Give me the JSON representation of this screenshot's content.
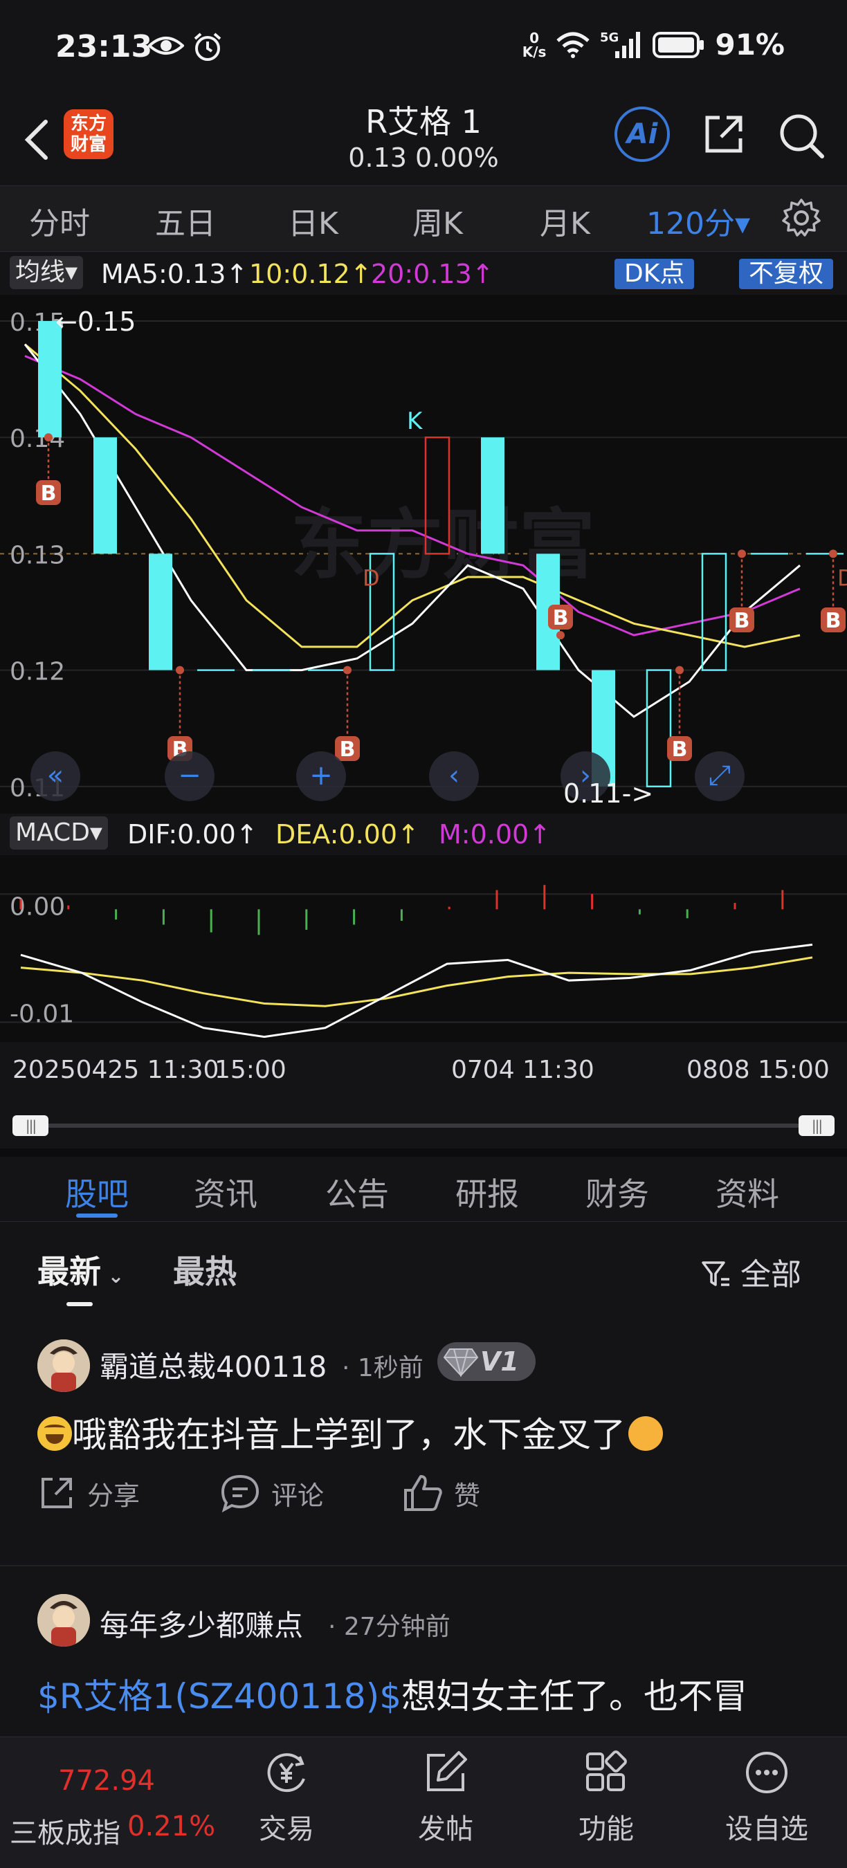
{
  "status_bar": {
    "time": "23:13",
    "net_speed_value": "0",
    "net_speed_unit": "K/s",
    "battery": "91%"
  },
  "header": {
    "logo_text": "东方财富",
    "title": "R艾格 1",
    "subtitle": "0.13   0.00%",
    "ai_label": "Ai"
  },
  "period_tabs": {
    "tabs": [
      "分时",
      "五日",
      "日K",
      "周K",
      "月K",
      "120分▾"
    ],
    "active": "120分▾"
  },
  "ma_legend": {
    "selector": "均线▾",
    "ma5": "MA5:0.13↑",
    "ma10": "10:0.12↑",
    "ma20": "20:0.13↑",
    "dk_button": "DK点",
    "adjust_button": "不复权"
  },
  "price_axis": [
    "0.15",
    "0.14",
    "0.13",
    "0.12",
    "0.11"
  ],
  "price_chart_labels": {
    "high": "←0.15",
    "low": "0.11->",
    "k_mark": "K",
    "d_mark": "D",
    "b_mark": "B"
  },
  "macd_legend": {
    "selector": "MACD▾",
    "dif": "DIF:0.00↑",
    "dea": "DEA:0.00↑",
    "m": "M:0.00↑"
  },
  "macd_axis": [
    "0.00",
    "-0.01"
  ],
  "date_axis": [
    "20250425 11:30",
    "15:00",
    "0704 11:30",
    "0808 15:00"
  ],
  "colors": {
    "accent": "#3d82e6",
    "up": "#e0302c",
    "down": "#5ef1f1",
    "ma5": "#ffffff",
    "ma10": "#f3e35c",
    "ma20": "#d13ad6",
    "macd_neg": "#4caf50"
  },
  "content_tabs": {
    "tabs": [
      "股吧",
      "资讯",
      "公告",
      "研报",
      "财务",
      "资料"
    ],
    "active": "股吧"
  },
  "sort_bar": {
    "latest": "最新",
    "hottest": "最热",
    "filter": "全部"
  },
  "posts": [
    {
      "user": "霸道总裁400118",
      "time": "1秒前",
      "level": "V1",
      "text": "哦豁我在抖音上学到了，水下金叉了",
      "actions": [
        "分享",
        "评论",
        "赞"
      ]
    },
    {
      "user": "每年多少都赚点",
      "time": "27分钟前",
      "link": "$R艾格1(SZ400118)$",
      "text": "想妇女主任了。也不冒"
    }
  ],
  "bottom_nav": {
    "index_value": "772.94",
    "index_name": "三板成指",
    "index_change": "0.21%",
    "items": [
      {
        "label": "交易",
        "icon": "yen-trade-icon"
      },
      {
        "label": "发帖",
        "icon": "compose-icon"
      },
      {
        "label": "功能",
        "icon": "grid-apps-icon"
      },
      {
        "label": "设自选",
        "icon": "more-dots-icon"
      }
    ]
  },
  "chart_data": {
    "type": "candlestick",
    "title": "",
    "period": "120分",
    "y_axis": {
      "ticks": [
        0.15,
        0.14,
        0.13,
        0.12,
        0.11
      ],
      "range": [
        0.11,
        0.15
      ]
    },
    "candles": [
      {
        "open": 0.14,
        "close": 0.15,
        "high": 0.15,
        "low": 0.14,
        "dir": "down"
      },
      {
        "open": 0.14,
        "close": 0.13,
        "high": 0.14,
        "low": 0.13,
        "dir": "down"
      },
      {
        "open": 0.13,
        "close": 0.12,
        "high": 0.13,
        "low": 0.12,
        "dir": "down"
      },
      {
        "open": 0.12,
        "close": 0.12,
        "high": 0.12,
        "low": 0.12,
        "dir": "flat"
      },
      {
        "open": 0.12,
        "close": 0.12,
        "high": 0.12,
        "low": 0.12,
        "dir": "flat"
      },
      {
        "open": 0.12,
        "close": 0.12,
        "high": 0.12,
        "low": 0.12,
        "dir": "flat"
      },
      {
        "open": 0.12,
        "close": 0.13,
        "high": 0.13,
        "low": 0.12,
        "dir": "up_hollow"
      },
      {
        "open": 0.13,
        "close": 0.14,
        "high": 0.14,
        "low": 0.13,
        "dir": "up_hollow_red"
      },
      {
        "open": 0.14,
        "close": 0.13,
        "high": 0.14,
        "low": 0.13,
        "dir": "down"
      },
      {
        "open": 0.13,
        "close": 0.12,
        "high": 0.13,
        "low": 0.12,
        "dir": "down"
      },
      {
        "open": 0.12,
        "close": 0.11,
        "high": 0.12,
        "low": 0.11,
        "dir": "down"
      },
      {
        "open": 0.11,
        "close": 0.12,
        "high": 0.12,
        "low": 0.11,
        "dir": "up_hollow"
      },
      {
        "open": 0.12,
        "close": 0.13,
        "high": 0.13,
        "low": 0.12,
        "dir": "up_hollow"
      },
      {
        "open": 0.13,
        "close": 0.13,
        "high": 0.13,
        "low": 0.13,
        "dir": "flat"
      },
      {
        "open": 0.13,
        "close": 0.13,
        "high": 0.13,
        "low": 0.13,
        "dir": "flat"
      }
    ],
    "ma5": [
      0.148,
      0.142,
      0.134,
      0.126,
      0.12,
      0.12,
      0.121,
      0.124,
      0.129,
      0.127,
      0.12,
      0.116,
      0.119,
      0.125,
      0.129
    ],
    "ma10": [
      0.148,
      0.144,
      0.139,
      0.133,
      0.126,
      0.122,
      0.122,
      0.126,
      0.128,
      0.128,
      0.126,
      0.124,
      0.123,
      0.122,
      0.123
    ],
    "ma20": [
      0.147,
      0.145,
      0.142,
      0.14,
      0.137,
      0.134,
      0.132,
      0.132,
      0.13,
      0.129,
      0.125,
      0.123,
      0.124,
      0.125,
      0.127
    ],
    "macd": {
      "y_ticks": [
        0.0,
        -0.01
      ],
      "hist": [
        0.0008,
        0.0003,
        -0.0008,
        -0.0012,
        -0.0018,
        -0.002,
        -0.0016,
        -0.0012,
        -0.0009,
        0.0002,
        0.0015,
        0.0019,
        0.0012,
        -0.0004,
        -0.0007,
        0.0005,
        0.0015
      ],
      "dif": [
        -0.0028,
        -0.0042,
        -0.0065,
        -0.0085,
        -0.0092,
        -0.0085,
        -0.006,
        -0.0035,
        -0.0032,
        -0.0048,
        -0.0046,
        -0.004,
        -0.0026,
        -0.002
      ],
      "dea": [
        -0.0038,
        -0.0042,
        -0.0048,
        -0.0058,
        -0.0066,
        -0.0068,
        -0.0062,
        -0.0052,
        -0.0045,
        -0.0042,
        -0.0043,
        -0.0043,
        -0.0038,
        -0.003
      ]
    }
  }
}
